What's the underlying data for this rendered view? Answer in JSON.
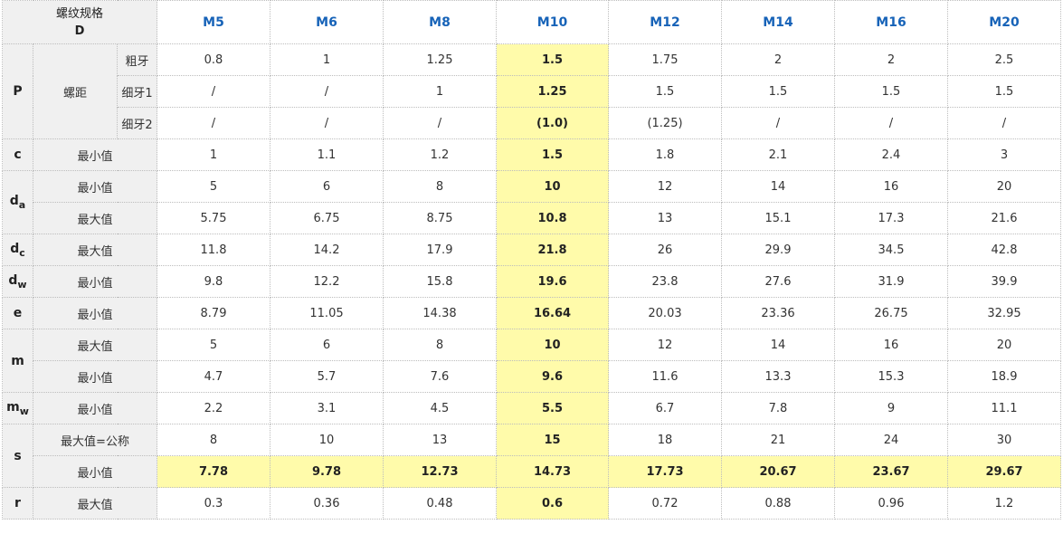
{
  "header": {
    "name_line1": "螺纹规格",
    "name_line2": "D",
    "sizes": [
      "M5",
      "M6",
      "M8",
      "M10",
      "M12",
      "M14",
      "M16",
      "M20"
    ]
  },
  "labels": {
    "pitch": "螺距",
    "coarse": "粗牙",
    "fine1": "细牙1",
    "fine2": "细牙2",
    "min": "最小值",
    "max": "最大值",
    "max_nominal": "最大值=公称"
  },
  "symbols": {
    "P": "P",
    "c": "c",
    "da": {
      "base": "d",
      "sub": "a"
    },
    "dc": {
      "base": "d",
      "sub": "c"
    },
    "dw": {
      "base": "d",
      "sub": "w"
    },
    "e": "e",
    "m": "m",
    "mw": {
      "base": "m",
      "sub": "w"
    },
    "s": "s",
    "r": "r"
  },
  "rows": {
    "p_coarse": [
      "0.8",
      "1",
      "1.25",
      "1.5",
      "1.75",
      "2",
      "2",
      "2.5"
    ],
    "p_fine1": [
      "/",
      "/",
      "1",
      "1.25",
      "1.5",
      "1.5",
      "1.5",
      "1.5"
    ],
    "p_fine2": [
      "/",
      "/",
      "/",
      "(1.0)",
      "(1.25)",
      "/",
      "/",
      "/"
    ],
    "c_min": [
      "1",
      "1.1",
      "1.2",
      "1.5",
      "1.8",
      "2.1",
      "2.4",
      "3"
    ],
    "da_min": [
      "5",
      "6",
      "8",
      "10",
      "12",
      "14",
      "16",
      "20"
    ],
    "da_max": [
      "5.75",
      "6.75",
      "8.75",
      "10.8",
      "13",
      "15.1",
      "17.3",
      "21.6"
    ],
    "dc_max": [
      "11.8",
      "14.2",
      "17.9",
      "21.8",
      "26",
      "29.9",
      "34.5",
      "42.8"
    ],
    "dw_min": [
      "9.8",
      "12.2",
      "15.8",
      "19.6",
      "23.8",
      "27.6",
      "31.9",
      "39.9"
    ],
    "e_min": [
      "8.79",
      "11.05",
      "14.38",
      "16.64",
      "20.03",
      "23.36",
      "26.75",
      "32.95"
    ],
    "m_max": [
      "5",
      "6",
      "8",
      "10",
      "12",
      "14",
      "16",
      "20"
    ],
    "m_min": [
      "4.7",
      "5.7",
      "7.6",
      "9.6",
      "11.6",
      "13.3",
      "15.3",
      "18.9"
    ],
    "mw_min": [
      "2.2",
      "3.1",
      "4.5",
      "5.5",
      "6.7",
      "7.8",
      "9",
      "11.1"
    ],
    "s_max": [
      "8",
      "10",
      "13",
      "15",
      "18",
      "21",
      "24",
      "30"
    ],
    "s_min": [
      "7.78",
      "9.78",
      "12.73",
      "14.73",
      "17.73",
      "20.67",
      "23.67",
      "29.67"
    ],
    "r_max": [
      "0.3",
      "0.36",
      "0.48",
      "0.6",
      "0.72",
      "0.88",
      "0.96",
      "1.2"
    ]
  },
  "colors": {
    "highlight": "#fffbaa",
    "size_text": "#1763b8",
    "label_bg": "#f0f0f0"
  }
}
